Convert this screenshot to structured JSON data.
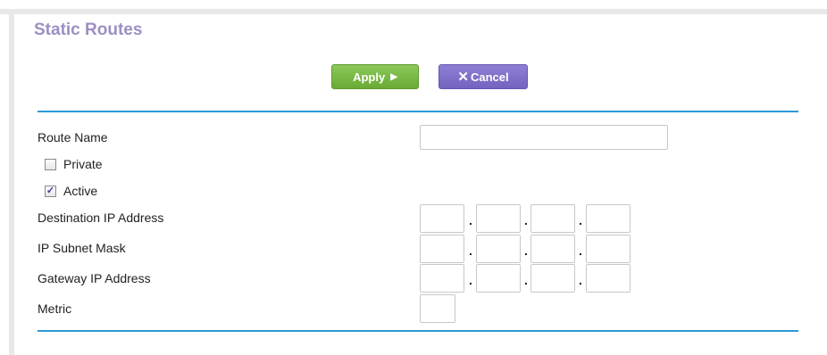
{
  "page": {
    "title": "Static Routes"
  },
  "actions": {
    "apply_label": "Apply",
    "apply_icon": "play-arrow-icon",
    "cancel_label": "Cancel",
    "cancel_icon": "close-x-icon"
  },
  "form": {
    "route_name": {
      "label": "Route Name",
      "value": ""
    },
    "private": {
      "label": "Private",
      "checked": false
    },
    "active": {
      "label": "Active",
      "checked": true
    },
    "destination_ip": {
      "label": "Destination IP Address",
      "octets": [
        "",
        "",
        "",
        ""
      ]
    },
    "subnet_mask": {
      "label": "IP Subnet Mask",
      "octets": [
        "",
        "",
        "",
        ""
      ]
    },
    "gateway_ip": {
      "label": "Gateway IP Address",
      "octets": [
        "",
        "",
        "",
        ""
      ]
    },
    "metric": {
      "label": "Metric",
      "value": ""
    },
    "separator": "."
  },
  "colors": {
    "title": "#9d8fc2",
    "apply": "#7bbb46",
    "cancel": "#8170c9",
    "rule": "#2a9ad7"
  }
}
